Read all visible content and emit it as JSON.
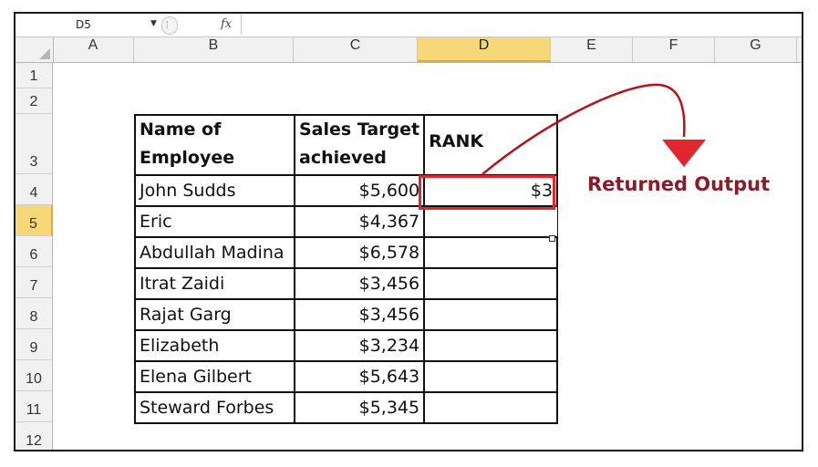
{
  "formula_bar": {
    "name_box": "D5",
    "fx_label": "fx",
    "formula": ""
  },
  "columns": [
    "A",
    "B",
    "C",
    "D",
    "E",
    "F",
    "G"
  ],
  "selected_column": "D",
  "rows": [
    "1",
    "2",
    "3",
    "4",
    "5",
    "6",
    "7",
    "8",
    "9",
    "10",
    "11",
    "12"
  ],
  "selected_row": "5",
  "table": {
    "headers": {
      "name_line1": "Name of",
      "name_line2": "Employee",
      "sales_line1": "Sales Target",
      "sales_line2": "achieved",
      "rank": "RANK"
    },
    "records": [
      {
        "name": "John Sudds",
        "sales": "$5,600",
        "rank": "$3"
      },
      {
        "name": "Eric",
        "sales": "$4,367",
        "rank": ""
      },
      {
        "name": "Abdullah Madina",
        "sales": "$6,578",
        "rank": ""
      },
      {
        "name": "Itrat Zaidi",
        "sales": "$3,456",
        "rank": ""
      },
      {
        "name": "Rajat Garg",
        "sales": "$3,456",
        "rank": ""
      },
      {
        "name": "Elizabeth",
        "sales": "$3,234",
        "rank": ""
      },
      {
        "name": "Elena Gilbert",
        "sales": "$5,643",
        "rank": ""
      },
      {
        "name": "Steward Forbes",
        "sales": "$5,345",
        "rank": ""
      }
    ]
  },
  "annotation": {
    "label": "Returned Output",
    "color": "#8c1a29",
    "arrow_color": "#e0262f"
  }
}
